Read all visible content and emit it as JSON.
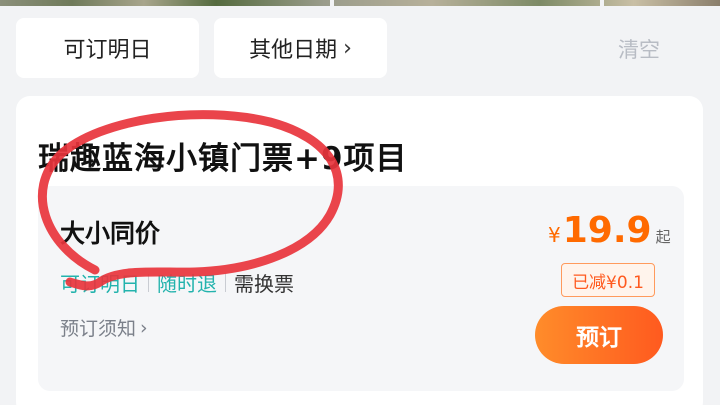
{
  "date_filter": {
    "today_label": "可订明日",
    "other_label": "其他日期",
    "clear_label": "清空"
  },
  "product": {
    "title": "瑞趣蓝海小镇门票+9项目",
    "ticket": {
      "name": "大小同价",
      "tags": [
        "可订明日",
        "随时退",
        "需换票"
      ],
      "notice_label": "预订须知",
      "price": {
        "currency": "¥",
        "amount": "19.9",
        "suffix": "起"
      },
      "discount_label": "已减¥0.1",
      "book_label": "预订"
    }
  },
  "colors": {
    "accent_orange": "#ff6a00",
    "tag_teal": "#23b3ad",
    "annotation_red": "#e8343c"
  },
  "icons": {
    "chevron": "chevron-right-icon"
  }
}
